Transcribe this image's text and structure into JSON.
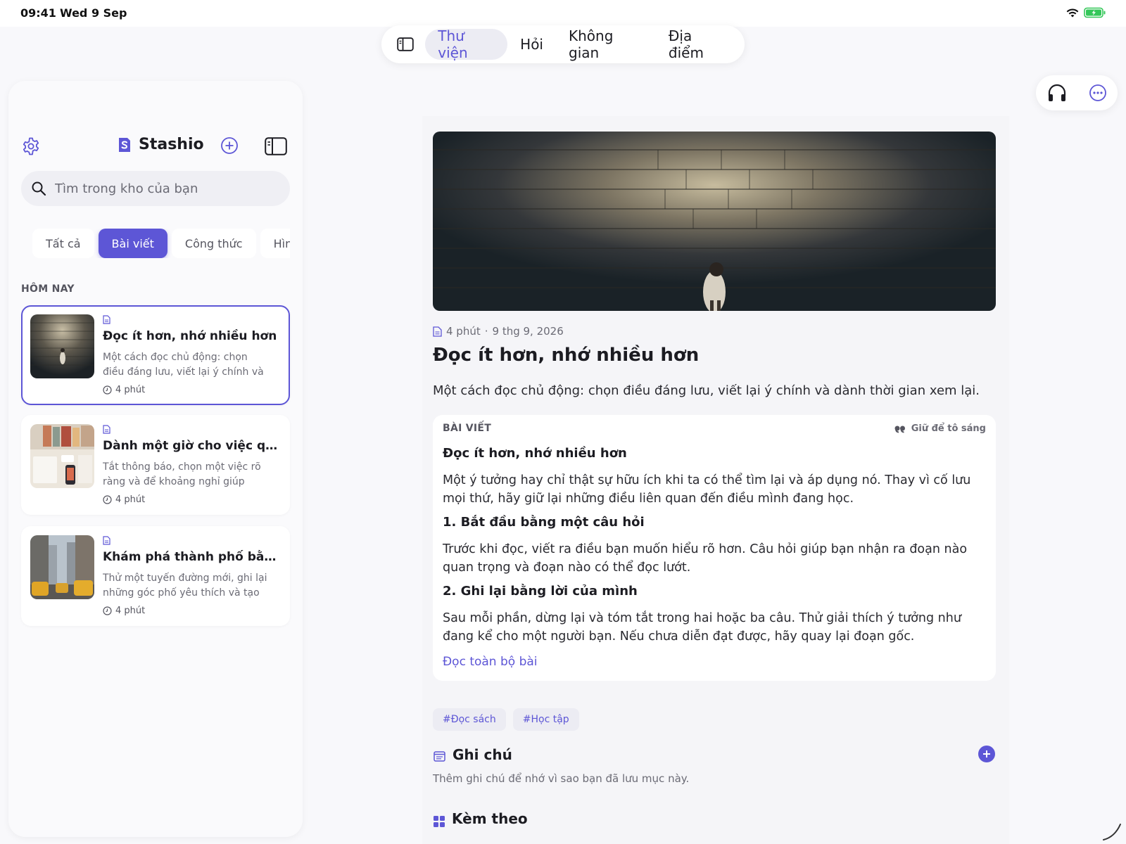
{
  "status": {
    "time": "09:41",
    "date": "Wed 9 Sep"
  },
  "topnav": {
    "tabs": [
      {
        "label": "Thư viện",
        "active": true
      },
      {
        "label": "Hỏi",
        "active": false
      },
      {
        "label": "Không gian",
        "active": false
      },
      {
        "label": "Địa điểm",
        "active": false
      }
    ]
  },
  "sidebar": {
    "brand": "Stashio",
    "search_placeholder": "Tìm trong kho của bạn",
    "filters": [
      "Tất cả",
      "Bài viết",
      "Công thức",
      "Hình"
    ],
    "active_filter": "Bài viết",
    "section_label": "HÔM NAY",
    "items": [
      {
        "title": "Đọc ít hơn, nhớ nhiều hơn",
        "desc": "Một cách đọc chủ động: chọn điều đáng lưu, viết lại ý chính và dành...",
        "time": "4 phút",
        "selected": true
      },
      {
        "title": "Dành một giờ cho việc qua...",
        "desc": "Tắt thông báo, chọn một việc rõ ràng và để khoảng nghỉ giúp bạn...",
        "time": "4 phút",
        "selected": false
      },
      {
        "title": "Khám phá thành phố bằng...",
        "desc": "Thử một tuyến đường mới, ghi lại những góc phố yêu thích và tạo b...",
        "time": "4 phút",
        "selected": false
      }
    ]
  },
  "article": {
    "meta_time": "4 phút",
    "meta_sep": "·",
    "meta_date": "9 thg 9, 2026",
    "title": "Đọc ít hơn, nhớ nhiều hơn",
    "subtitle": "Một cách đọc chủ động: chọn điều đáng lưu, viết lại ý chính và dành thời gian xem lại.",
    "content": {
      "label": "BÀI VIẾT",
      "highlight_hint": "Giữ để tô sáng",
      "heading": "Đọc ít hơn, nhớ nhiều hơn",
      "intro": "Một ý tưởng hay chỉ thật sự hữu ích khi ta có thể tìm lại và áp dụng nó. Thay vì cố lưu mọi thứ, hãy giữ lại những điều liên quan đến điều mình đang học.",
      "s1_title": "1. Bắt đầu bằng một câu hỏi",
      "s1_body": "Trước khi đọc, viết ra điều bạn muốn hiểu rõ hơn. Câu hỏi giúp bạn nhận ra đoạn nào quan trọng và đoạn nào có thể đọc lướt.",
      "s2_title": "2. Ghi lại bằng lời của mình",
      "s2_body": "Sau mỗi phần, dừng lại và tóm tắt trong hai hoặc ba câu. Thử giải thích ý tưởng như đang kể cho một người bạn. Nếu chưa diễn đạt được, hãy quay lại đoạn gốc.",
      "read_more": "Đọc toàn bộ bài"
    },
    "tags": [
      "#Đọc sách",
      "#Học tập"
    ],
    "notes_title": "Ghi chú",
    "notes_hint": "Thêm ghi chú để nhớ vì sao bạn đã lưu mục này.",
    "attachments_title": "Kèm theo"
  },
  "colors": {
    "accent": "#5d56d6",
    "background": "#f8f8fb",
    "battery": "#34c759"
  },
  "icons": [
    "sidebar-toggle-icon",
    "headphones-icon",
    "more-icon",
    "gear-icon",
    "brand-logo-icon",
    "add-icon",
    "panel-icon",
    "search-icon",
    "document-icon",
    "clock-icon",
    "quote-icon",
    "note-icon",
    "grid-icon",
    "wifi-icon",
    "battery-icon"
  ]
}
